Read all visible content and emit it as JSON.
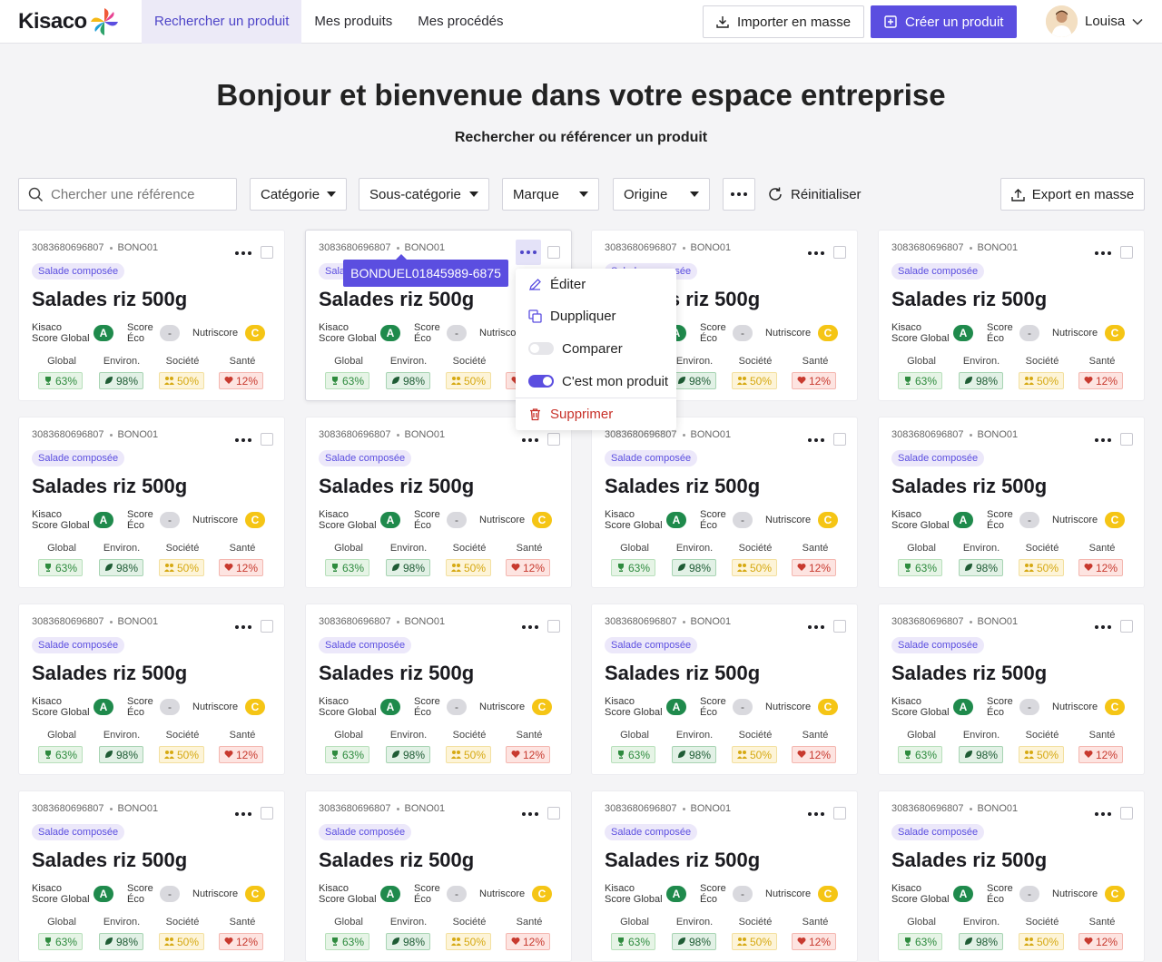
{
  "brand": {
    "name": "Kisaco"
  },
  "nav": {
    "items": [
      {
        "label": "Rechercher un produit",
        "active": true
      },
      {
        "label": "Mes produits",
        "active": false
      },
      {
        "label": "Mes procédés",
        "active": false
      }
    ]
  },
  "actions": {
    "import_label": "Importer en masse",
    "create_label": "Créer un produit"
  },
  "user": {
    "name": "Louisa"
  },
  "hero": {
    "title": "Bonjour et bienvenue dans votre espace entreprise",
    "subtitle": "Rechercher ou  référencer un produit"
  },
  "filters": {
    "search_placeholder": "Chercher une référence",
    "selects": [
      "Catégorie",
      "Sous-catégorie",
      "Marque",
      "Origine"
    ],
    "reset_label": "Réinitialiser",
    "export_label": "Export en masse"
  },
  "card_labels": {
    "kisaco_line1": "Kisaco",
    "kisaco_line2": "Score Global",
    "eco_line1": "Score",
    "eco_line2": "Éco",
    "nutri": "Nutriscore",
    "global": "Global",
    "env": "Environ.",
    "societe": "Société",
    "sante": "Santé"
  },
  "products": [
    {
      "code": "3083680696807",
      "ref": "BONO01",
      "tag": "Salade composée",
      "name": "Salades riz 500g",
      "kisaco_grade": "A",
      "eco_grade": "-",
      "nutri_grade": "C",
      "global": "63%",
      "env": "98%",
      "societe": "50%",
      "sante": "12%"
    }
  ],
  "tooltip": {
    "text": "BONDUEL01845989-6875"
  },
  "context_menu": {
    "edit": "Éditer",
    "duplicate": "Duppliquer",
    "compare": "Comparer",
    "compare_on": false,
    "mine": "C'est mon produit",
    "mine_on": true,
    "delete": "Supprimer"
  },
  "colors": {
    "accent": "#5b4ee0",
    "grade_green": "#1f8a4c",
    "grade_yellow": "#f5c515",
    "danger": "#c8322a"
  }
}
